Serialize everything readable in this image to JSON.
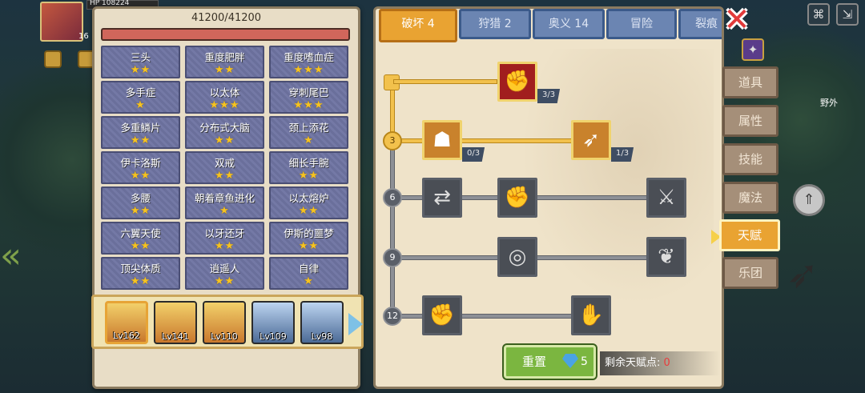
{
  "hero_header": {
    "hp_text": "HP 108224",
    "level_badge": "16"
  },
  "left": {
    "hp_text": "41200/41200",
    "traits": [
      {
        "name": "三头",
        "stars": "★★"
      },
      {
        "name": "重度肥胖",
        "stars": "★★"
      },
      {
        "name": "重度嗜血症",
        "stars": "★★★"
      },
      {
        "name": "多手症",
        "stars": "★"
      },
      {
        "name": "以太体",
        "stars": "★★★"
      },
      {
        "name": "穿刺尾巴",
        "stars": "★★★"
      },
      {
        "name": "多重鳞片",
        "stars": "★★"
      },
      {
        "name": "分布式大脑",
        "stars": "★★"
      },
      {
        "name": "颈上添花",
        "stars": "★"
      },
      {
        "name": "伊卡洛斯",
        "stars": "★★"
      },
      {
        "name": "双戒",
        "stars": "★★"
      },
      {
        "name": "细长手腕",
        "stars": "★★"
      },
      {
        "name": "多腰",
        "stars": "★★"
      },
      {
        "name": "朝着章鱼进化",
        "stars": "★"
      },
      {
        "name": "以太熔炉",
        "stars": "★★"
      },
      {
        "name": "六翼天使",
        "stars": "★★"
      },
      {
        "name": "以牙还牙",
        "stars": "★★"
      },
      {
        "name": "伊斯的噩梦",
        "stars": "★★"
      },
      {
        "name": "顶尖体质",
        "stars": "★★"
      },
      {
        "name": "逍遥人",
        "stars": "★★"
      },
      {
        "name": "自律",
        "stars": "★"
      }
    ],
    "heroes": [
      {
        "level": "Lv162",
        "selected": true
      },
      {
        "level": "Lv141"
      },
      {
        "level": "Lv110"
      },
      {
        "level": "Lv109"
      },
      {
        "level": "Lv98"
      }
    ]
  },
  "tabs": [
    {
      "label": "破坏 4",
      "active": true
    },
    {
      "label": "狩猎 2"
    },
    {
      "label": "奥义 14"
    },
    {
      "label": "冒险"
    },
    {
      "label": "裂痕"
    }
  ],
  "talent_tree": {
    "rows": [
      "3",
      "6",
      "9",
      "12"
    ],
    "nodes": [
      {
        "id": "arm-wrestle",
        "count": "3/3"
      },
      {
        "id": "body",
        "count": "0/3"
      },
      {
        "id": "arrow",
        "count": "1/3"
      }
    ]
  },
  "reset": {
    "label": "重置",
    "cost": "5"
  },
  "points": {
    "label": "剩余天赋点:",
    "value": "0"
  },
  "side_menu": [
    "道具",
    "属性",
    "技能",
    "魔法",
    "天赋",
    "乐团"
  ],
  "map": {
    "label": "野外"
  },
  "colors": {
    "accent": "#e9a332",
    "tab_blue": "#6b85b2",
    "panel": "#efe3c9"
  }
}
